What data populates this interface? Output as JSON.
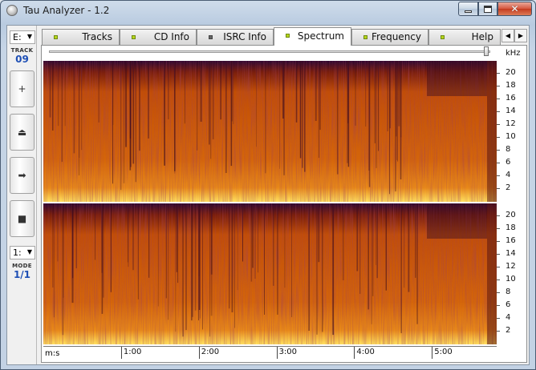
{
  "window": {
    "title": "Tau Analyzer - 1.2"
  },
  "sidebar": {
    "drive": "E:",
    "track_label": "TRACK",
    "track_number": "09",
    "buttons": [
      {
        "name": "add-button",
        "glyph": "+"
      },
      {
        "name": "eject-button",
        "glyph": "⏏"
      },
      {
        "name": "play-button",
        "glyph": "➡"
      },
      {
        "name": "stop-button",
        "glyph": "■"
      }
    ],
    "mode_select": "1:",
    "mode_label": "MODE",
    "mode_value": "1/1"
  },
  "tabs": [
    {
      "label": "Tracks",
      "led": "green",
      "active": false
    },
    {
      "label": "CD Info",
      "led": "green",
      "active": false
    },
    {
      "label": "ISRC Info",
      "led": "dark",
      "active": false
    },
    {
      "label": "Spectrum",
      "led": "green",
      "active": true
    },
    {
      "label": "Frequency",
      "led": "green",
      "active": false
    },
    {
      "label": "Help",
      "led": "green",
      "active": false
    }
  ],
  "spectrum": {
    "freq_unit": "kHz",
    "freq_ticks": [
      "20",
      "18",
      "16",
      "14",
      "12",
      "10",
      "8",
      "6",
      "4",
      "2"
    ],
    "time_unit": "m:s",
    "time_ticks": [
      "1:00",
      "2:00",
      "3:00",
      "4:00",
      "5:00"
    ],
    "duration_seconds": 350,
    "colors": {
      "low": "#2a0530",
      "mid": "#c24e06",
      "high": "#ffe060"
    }
  }
}
